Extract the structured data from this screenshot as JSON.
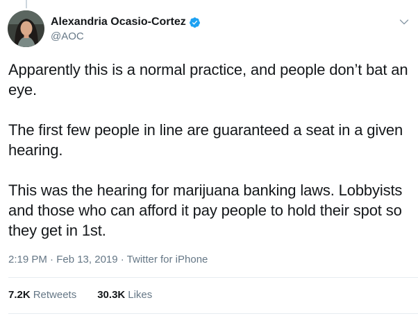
{
  "author": {
    "display_name": "Alexandria Ocasio-Cortez",
    "handle": "@AOC",
    "verified_icon": "verified-badge-icon",
    "avatar_icon": "avatar"
  },
  "tweet": {
    "paragraphs": [
      "Apparently this is a normal practice, and people don’t bat an eye.",
      "The first few people in line are guaranteed a seat in a given hearing.",
      "This was the hearing for marijuana banking laws. Lobbyists and those who can afford it pay people to hold their spot so they get in 1st."
    ],
    "meta": "2:19 PM · Feb 13, 2019 · Twitter for iPhone"
  },
  "stats": {
    "retweets_count": "7.2K",
    "retweets_label": "Retweets",
    "likes_count": "30.3K",
    "likes_label": "Likes"
  },
  "colors": {
    "verified": "#1da1f2",
    "secondary_text": "#657786",
    "primary_text": "#14171a"
  }
}
